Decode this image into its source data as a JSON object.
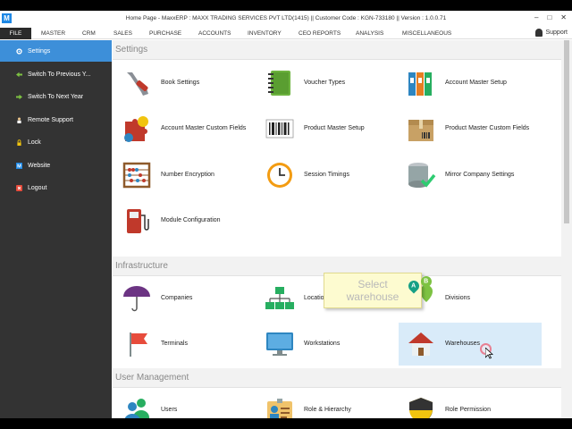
{
  "window": {
    "title": "Home Page - MaxxERP : MAXX TRADING SERVICES PVT LTD(1415)  ||  Customer Code : KGN-733180  ||  Version : 1.0.0.71",
    "logo": "M"
  },
  "menubar": {
    "items": [
      "FILE",
      "MASTER",
      "CRM",
      "SALES",
      "PURCHASE",
      "ACCOUNTS",
      "INVENTORY",
      "CEO REPORTS",
      "ANALYSIS",
      "MISCELLANEOUS"
    ],
    "support": "Support"
  },
  "sidebar": {
    "items": [
      {
        "label": "Settings",
        "icon": "gear-icon"
      },
      {
        "label": "Switch To Previous Y...",
        "icon": "arrow-left-icon"
      },
      {
        "label": "Switch To Next Year",
        "icon": "arrow-right-icon"
      },
      {
        "label": "Remote Support",
        "icon": "support-person-icon"
      },
      {
        "label": "Lock",
        "icon": "lock-icon"
      },
      {
        "label": "Website",
        "icon": "website-m-icon"
      },
      {
        "label": "Logout",
        "icon": "logout-icon"
      }
    ]
  },
  "sections": {
    "settings": "Settings",
    "infrastructure": "Infrastructure",
    "user_management": "User Management"
  },
  "tiles": {
    "book_settings": "Book Settings",
    "voucher_types": "Voucher Types",
    "account_master_setup": "Account Master Setup",
    "account_master_custom_fields": "Account Master Custom Fields",
    "product_master_setup": "Product Master Setup",
    "product_master_custom_fields": "Product Master Custom Fields",
    "number_encryption": "Number Encryption",
    "session_timings": "Session Timings",
    "mirror_company_settings": "Mirror Company Settings",
    "module_configuration": "Module Configuration",
    "companies": "Companies",
    "locations": "Locations",
    "divisions": "Divisions",
    "terminals": "Terminals",
    "workstations": "Workstations",
    "warehouses": "Warehouses",
    "users": "Users",
    "role_hierarchy": "Role & Hierarchy",
    "role_permission": "Role Permission"
  },
  "tooltip": {
    "line1": "Select",
    "line2": "warehouse",
    "pin_a": "A",
    "pin_b": "B"
  },
  "colors": {
    "sidebar_bg": "#333333",
    "active_blue": "#3d8fd9",
    "hover_tile": "#d9ebf9",
    "tooltip_bg": "#fdfbd0"
  }
}
